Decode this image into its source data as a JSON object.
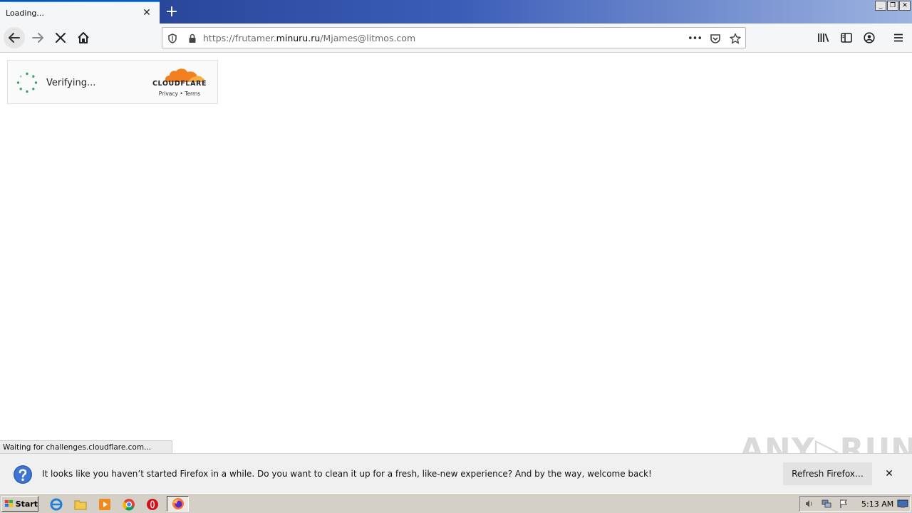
{
  "browser": {
    "tab": {
      "title": "Loading...",
      "close_label": "✕"
    },
    "new_tab_label": "+",
    "window_controls": {
      "minimize": "_",
      "restore": "❐",
      "close": "✕"
    },
    "url": {
      "prefix": "https://frutamer.",
      "domain": "minuru.ru",
      "suffix": "/Mjames@litmos.com"
    },
    "page_actions_label": "•••"
  },
  "cloudflare_widget": {
    "status_text": "Verifying...",
    "brand": "CLOUDFLARE",
    "links": "Privacy • Terms",
    "accent_color": "#f38020"
  },
  "status_bar": {
    "text": "Waiting for challenges.cloudflare.com..."
  },
  "notification": {
    "message": "It looks like you haven’t started Firefox in a while. Do you want to clean it up for a fresh, like-new experience? And by the way, welcome back!",
    "button_label": "Refresh Firefox…",
    "close_label": "✕"
  },
  "watermark": {
    "text": "ANY▷RUN"
  },
  "taskbar": {
    "start_label": "Start",
    "clock": "5:13 AM"
  }
}
